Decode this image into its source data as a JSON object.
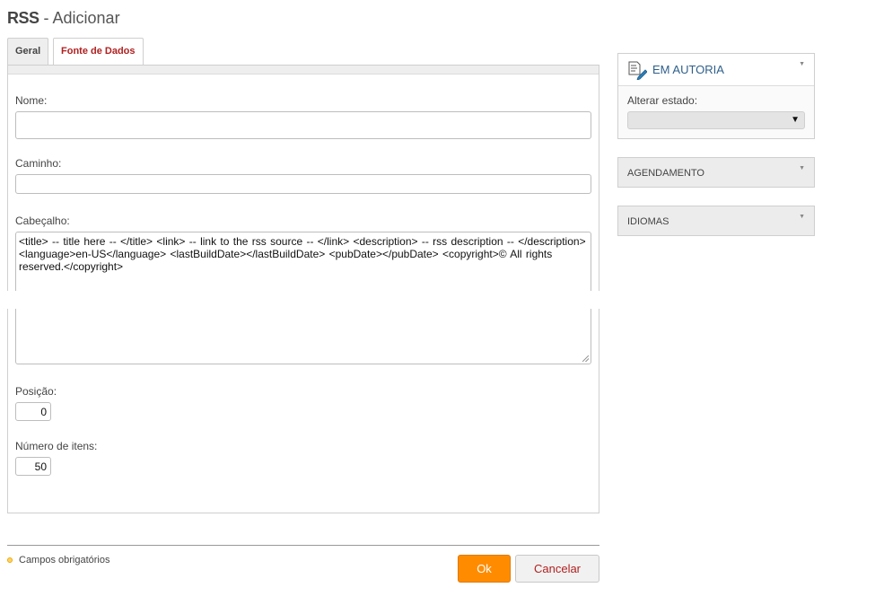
{
  "header": {
    "title_strong": "RSS",
    "title_rest": " - Adicionar"
  },
  "tabs": [
    {
      "label": "Geral",
      "active": true
    },
    {
      "label": "Fonte de Dados",
      "active": false
    }
  ],
  "form": {
    "name_label": "Nome:",
    "name_value": "",
    "path_label": "Caminho:",
    "path_value": "",
    "header_label": "Cabeçalho:",
    "header_value": "<title> -- title here -- </title>  <link> -- link to the rss source -- </link>  <description> -- rss description -- </description>  <language>en-US</language>  <lastBuildDate></lastBuildDate>  <pubDate></pubDate>  <copyright>© All rights reserved.</copyright>",
    "position_label": "Posição:",
    "position_value": "0",
    "items_label": "Número de itens:",
    "items_value": "50"
  },
  "footer": {
    "required_text": "Campos obrigatórios",
    "ok_label": "Ok",
    "cancel_label": "Cancelar"
  },
  "sidebar": {
    "status_title": "EM AUTORIA",
    "status_change_label": "Alterar estado:",
    "status_select_value": "",
    "scheduling_title": "AGENDAMENTO",
    "languages_title": "IDIOMAS"
  },
  "colors": {
    "accent_orange": "#ff8c00",
    "link_red": "#b02121",
    "status_blue": "#2e5f8a"
  },
  "icons": [
    "document-edit-icon",
    "chevron-down-icon",
    "required-marker-icon"
  ]
}
